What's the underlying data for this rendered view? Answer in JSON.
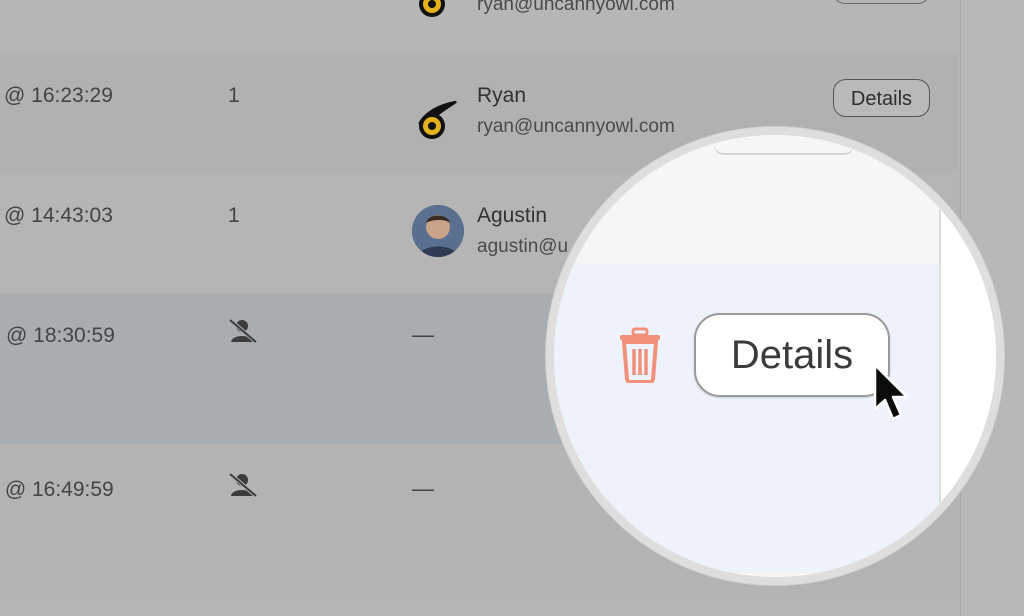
{
  "rows": [
    {
      "time": "",
      "count": "",
      "user": {
        "name": "",
        "email": "ryan@uncannyowl.com",
        "avatar": "owl-icon"
      }
    },
    {
      "time": "@ 16:23:29",
      "count": "1",
      "user": {
        "name": "Ryan",
        "email": "ryan@uncannyowl.com",
        "avatar": "owl-icon"
      },
      "action": "Details"
    },
    {
      "time": "@ 14:43:03",
      "count": "1",
      "user": {
        "name": "Agustin",
        "email": "agustin@u",
        "avatar": "photo"
      }
    },
    {
      "time": "@ 18:30:59",
      "count_icon": "user-off-icon",
      "user_placeholder": "—"
    },
    {
      "time": "- @ 16:49:59",
      "count_icon": "user-off-icon",
      "user_placeholder": "—"
    }
  ],
  "magnifier": {
    "button_label": "Details",
    "delete_icon": "trash-icon",
    "pointer": "cursor-arrow-icon",
    "delete_color": "#f0907a"
  }
}
